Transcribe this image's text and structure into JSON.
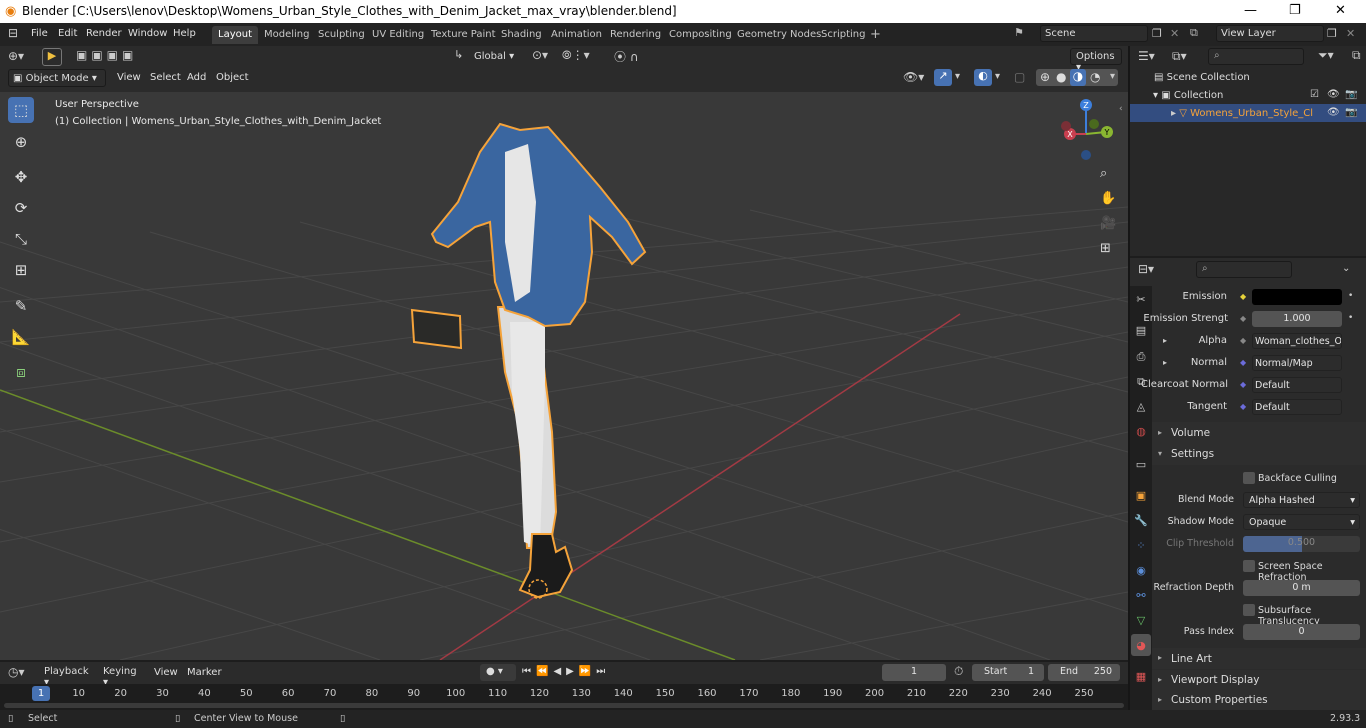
{
  "window": {
    "title": "Blender [C:\\Users\\lenov\\Desktop\\Womens_Urban_Style_Clothes_with_Denim_Jacket_max_vray\\blender.blend]"
  },
  "menu": [
    "File",
    "Edit",
    "Render",
    "Window",
    "Help"
  ],
  "workspaces": [
    "Layout",
    "Modeling",
    "Sculpting",
    "UV Editing",
    "Texture Paint",
    "Shading",
    "Animation",
    "Rendering",
    "Compositing",
    "Geometry Nodes",
    "Scripting"
  ],
  "scene": {
    "name": "Scene",
    "view_layer": "View Layer"
  },
  "viewport": {
    "mode": "Object Mode",
    "menus": [
      "View",
      "Select",
      "Add",
      "Object"
    ],
    "transform_orientation": "Global",
    "options_label": "Options",
    "overlay_title": "User Perspective",
    "overlay_subtitle": "(1) Collection | Womens_Urban_Style_Clothes_with_Denim_Jacket",
    "gizmo": {
      "x": "X",
      "y": "Y",
      "z": "Z"
    }
  },
  "outliner": {
    "items": [
      {
        "label": "Scene Collection"
      },
      {
        "label": "Collection"
      },
      {
        "label": "Womens_Urban_Style_Cl"
      }
    ]
  },
  "properties": {
    "rows": {
      "emission": {
        "label": "Emission",
        "value": ""
      },
      "emission_strength": {
        "label": "Emission Strengt",
        "value": "1.000"
      },
      "alpha": {
        "label": "Alpha",
        "value": "Woman_clothes_Op..."
      },
      "normal": {
        "label": "Normal",
        "value": "Normal/Map"
      },
      "clearcoat_normal": {
        "label": "Clearcoat Normal",
        "value": "Default"
      },
      "tangent": {
        "label": "Tangent",
        "value": "Default"
      }
    },
    "panels": {
      "volume": "Volume",
      "settings": "Settings",
      "line_art": "Line Art",
      "viewport_display": "Viewport Display",
      "custom_properties": "Custom Properties"
    },
    "settings": {
      "backface_culling": "Backface Culling",
      "blend_mode_label": "Blend Mode",
      "blend_mode": "Alpha Hashed",
      "shadow_mode_label": "Shadow Mode",
      "shadow_mode": "Opaque",
      "clip_threshold_label": "Clip Threshold",
      "clip_threshold": "0.500",
      "ssr": "Screen Space Refraction",
      "refraction_depth_label": "Refraction Depth",
      "refraction_depth": "0 m",
      "subsurface": "Subsurface Translucency",
      "pass_index_label": "Pass Index",
      "pass_index": "0"
    }
  },
  "timeline": {
    "menus": [
      "Playback",
      "Keying",
      "View",
      "Marker"
    ],
    "current_frame": "1",
    "start_label": "Start",
    "start": "1",
    "end_label": "End",
    "end": "250",
    "ticks": [
      "1",
      "10",
      "20",
      "30",
      "40",
      "50",
      "60",
      "70",
      "80",
      "90",
      "100",
      "110",
      "120",
      "130",
      "140",
      "150",
      "160",
      "170",
      "180",
      "190",
      "200",
      "210",
      "220",
      "230",
      "240",
      "250"
    ]
  },
  "status": {
    "left": "Select",
    "mid": "Center View to Mouse",
    "version": "2.93.3"
  },
  "colors": {
    "accent": "#4772b3",
    "selection": "#f5a33a",
    "x_axis": "#c83f4f",
    "y_axis": "#8ab631",
    "z_axis": "#3d7fdc"
  }
}
